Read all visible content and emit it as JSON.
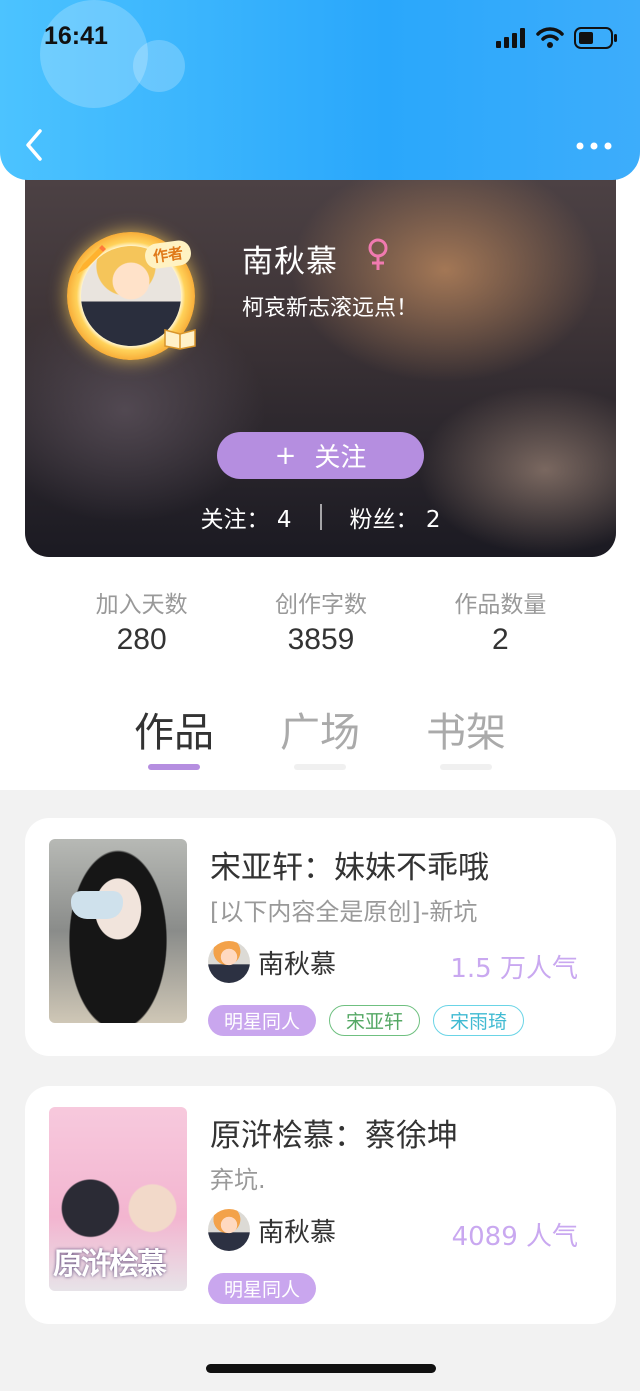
{
  "status_bar": {
    "time": "16:41"
  },
  "profile": {
    "badge": "作者",
    "name": "南秋慕",
    "motto": "柯哀新志滚远点！",
    "follow_plus": "+",
    "follow_label": "关注",
    "following_label": "关注：",
    "following_count": "4",
    "fans_label": "粉丝：",
    "fans_count": "2"
  },
  "stats": [
    {
      "label": "加入天数",
      "value": "280"
    },
    {
      "label": "创作字数",
      "value": "3859"
    },
    {
      "label": "作品数量",
      "value": "2"
    }
  ],
  "tabs": [
    {
      "label": "作品",
      "active": true
    },
    {
      "label": "广场",
      "active": false
    },
    {
      "label": "书架",
      "active": false
    }
  ],
  "books": [
    {
      "title": "宋亚轩：妹妹不乖哦",
      "desc": "[以下内容全是原创]-新坑",
      "author": "南秋慕",
      "popularity": "1.5 万人气",
      "tags": [
        "明星同人",
        "宋亚轩",
        "宋雨琦"
      ]
    },
    {
      "title": "原浒桧慕：蔡徐坤",
      "desc": "弃坑.",
      "author": "南秋慕",
      "popularity": "4089 人气",
      "tags": [
        "明星同人"
      ],
      "cover_text": "原浒桧慕"
    }
  ],
  "colors": {
    "header": "#2aa7fb",
    "accent": "#b58ee0",
    "popularity": "#c9a8f0"
  }
}
